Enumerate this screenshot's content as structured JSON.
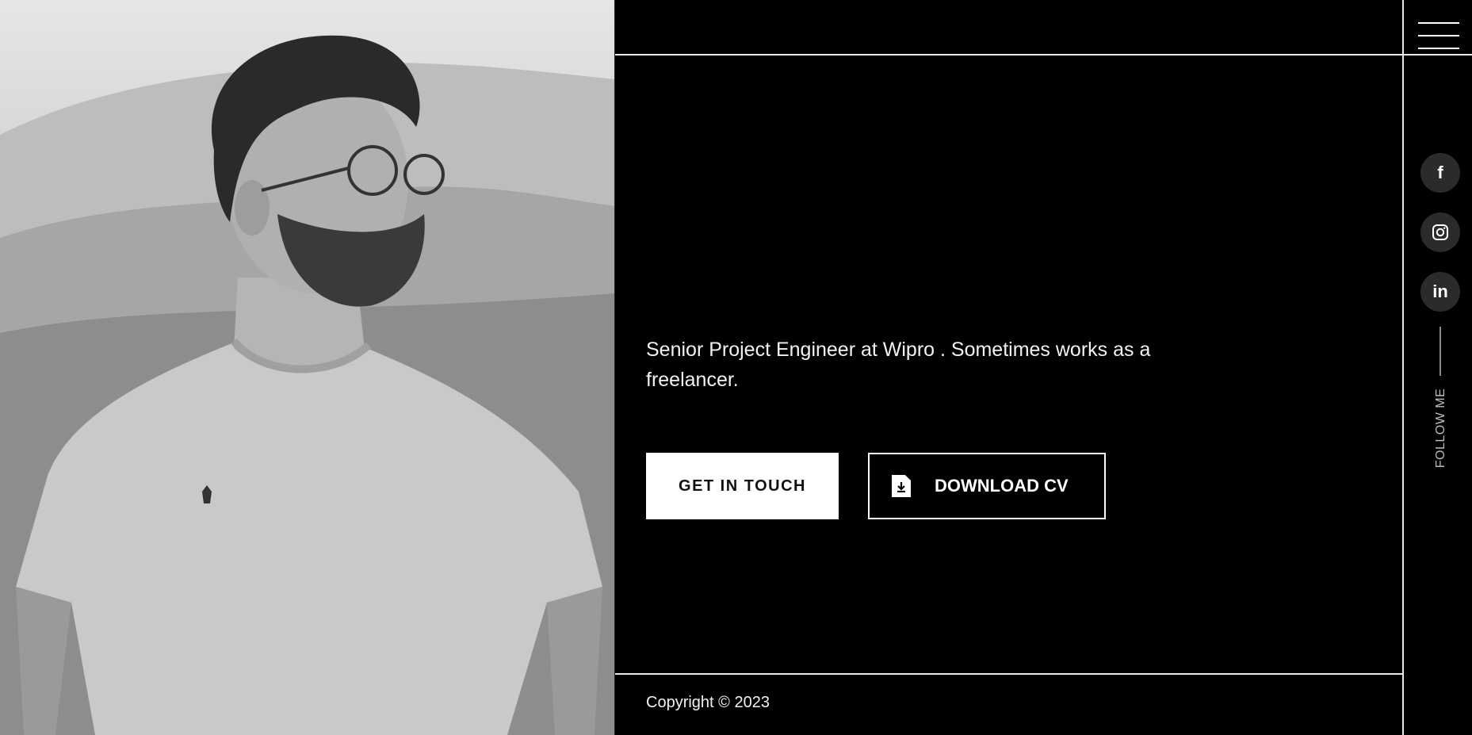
{
  "profile": {
    "photo_alt": "Portrait photo"
  },
  "header": {
    "menu_icon": "hamburger-menu-icon"
  },
  "hero": {
    "tagline": "Senior Project Engineer at Wipro . Sometimes works as a freelancer.",
    "primary_button": "GET IN TOUCH",
    "secondary_button": "DOWNLOAD CV",
    "secondary_icon": "file-download-icon"
  },
  "social": {
    "items": [
      {
        "name": "facebook",
        "glyph": "f",
        "icon": "facebook-icon"
      },
      {
        "name": "instagram",
        "glyph": "",
        "icon": "instagram-icon"
      },
      {
        "name": "linkedin",
        "glyph": "in",
        "icon": "linkedin-icon"
      }
    ],
    "follow_label": "FOLLOW ME"
  },
  "footer": {
    "copyright": "Copyright © 2023"
  },
  "colors": {
    "background": "#000000",
    "line": "#e8e8e8",
    "social_bg": "#2b2b2b"
  }
}
